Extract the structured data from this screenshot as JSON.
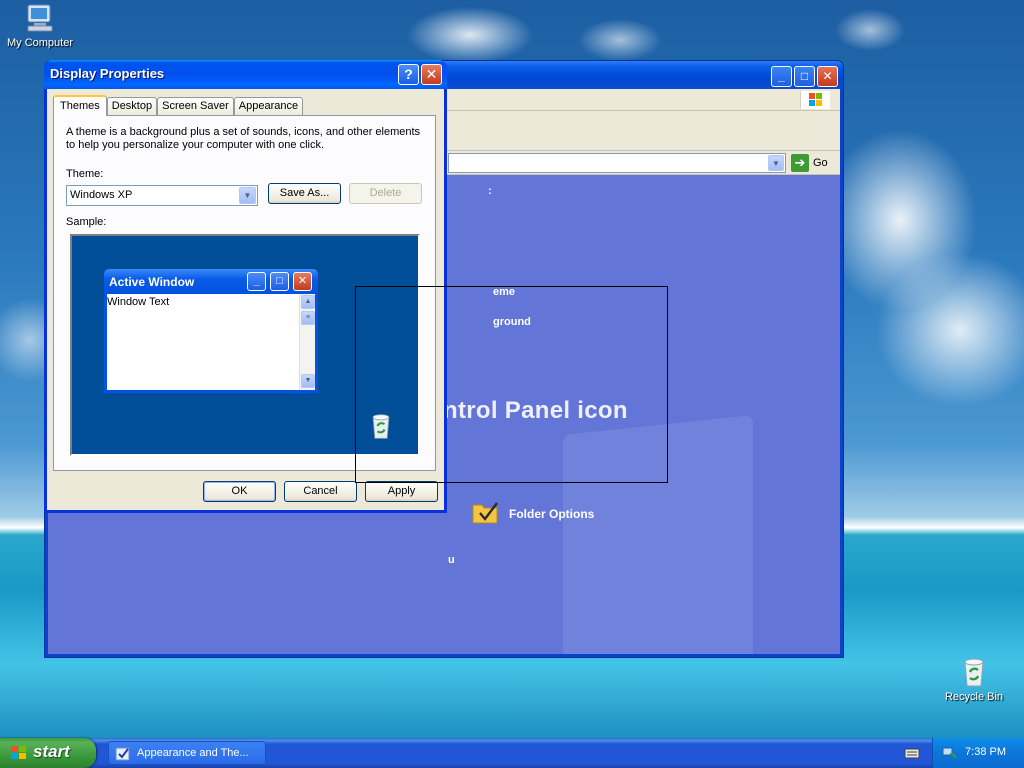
{
  "desktop": {
    "icons": [
      {
        "label": "My Computer",
        "icon": "my-computer-icon"
      },
      {
        "label": "Recycle Bin",
        "icon": "recycle-bin-icon"
      }
    ]
  },
  "control_panel_window": {
    "address_go": "Go",
    "body": {
      "snippet_1": ":",
      "snippet_2": "eme",
      "snippet_3": "ground",
      "heading_fragment": "ntrol Panel icon",
      "folder_options": "Folder Options",
      "snippet_4": "u"
    }
  },
  "dialog": {
    "title": "Display Properties",
    "tabs": [
      "Themes",
      "Desktop",
      "Screen Saver",
      "Appearance"
    ],
    "active_tab": "Themes",
    "description": "A theme is a background plus a set of sounds, icons, and other elements to help you personalize your computer with one click.",
    "theme_label": "Theme:",
    "theme_value": "Windows XP",
    "save_as": "Save As...",
    "delete": "Delete",
    "sample_label": "Sample:",
    "sample_window": {
      "title": "Active Window",
      "text": "Window Text"
    },
    "ok": "OK",
    "cancel": "Cancel",
    "apply": "Apply"
  },
  "taskbar": {
    "start": "start",
    "task": "Appearance and The...",
    "clock": "7:38 PM"
  },
  "colors": {
    "xp_blue_title": "#0053ee",
    "dialog_face": "#ece9d8",
    "control_panel_body": "#6375d6",
    "start_green": "#3b9a3b"
  }
}
